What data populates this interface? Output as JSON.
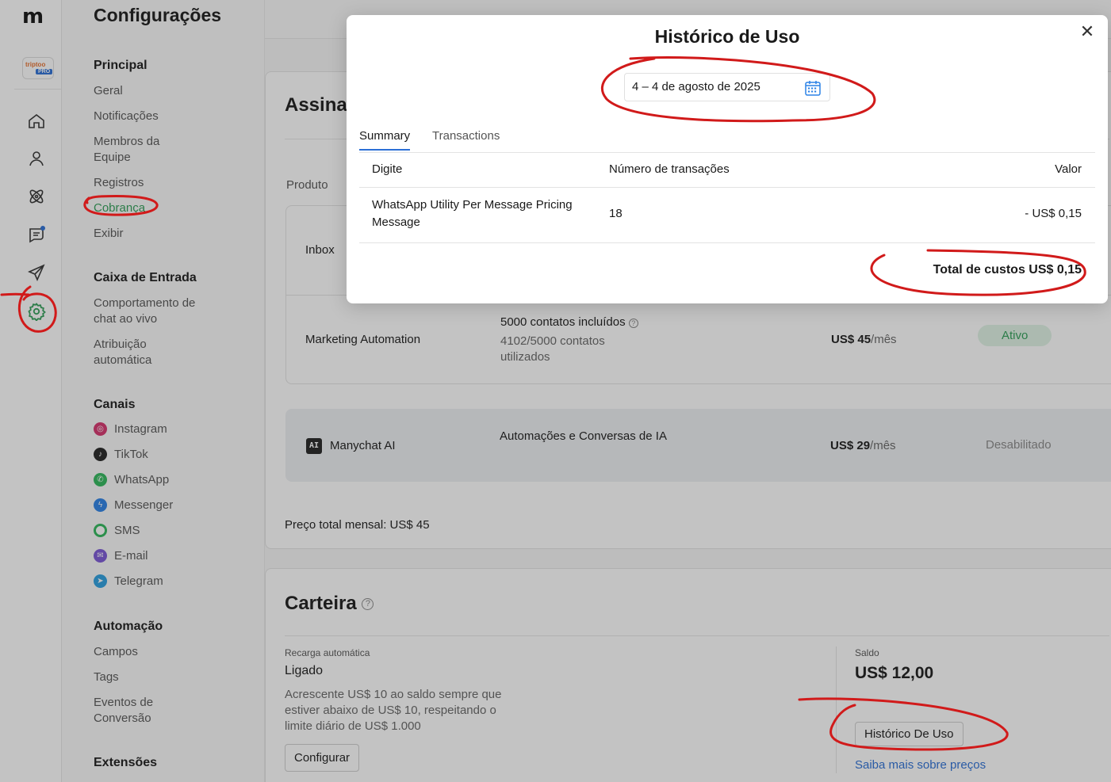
{
  "nav": {
    "page_title": "Configurações",
    "brand": {
      "name": "triptoo",
      "badge": "PRO"
    },
    "sections": {
      "principal": "Principal",
      "caixa": "Caixa de Entrada",
      "canais": "Canais",
      "automacao": "Automação",
      "extensoes": "Extensões"
    },
    "principal_items": [
      "Geral",
      "Notificações",
      "Membros da Equipe",
      "Registros",
      "Cobrança",
      "Exibir"
    ],
    "caixa_items": [
      "Comportamento de chat ao vivo",
      "Atribuição automática"
    ],
    "channels": [
      "Instagram",
      "TikTok",
      "WhatsApp",
      "Messenger",
      "SMS",
      "E-mail",
      "Telegram"
    ],
    "automacao_items": [
      "Campos",
      "Tags",
      "Eventos de Conversão"
    ]
  },
  "subscription": {
    "title": "Assinatura",
    "col_product": "Produto",
    "rows": [
      {
        "name": "Inbox"
      },
      {
        "name": "Marketing Automation",
        "detail": "5000 contatos incluídos",
        "usage": "4102/5000 contatos utilizados",
        "price": "US$ 45",
        "unit": "/mês",
        "status": "Ativo"
      },
      {
        "name": "Manychat AI",
        "badge": "AI",
        "detail": "Automações e Conversas de IA",
        "price": "US$ 29",
        "unit": "/mês",
        "status": "Desabilitado"
      }
    ],
    "total": "Preço total mensal: US$ 45"
  },
  "wallet": {
    "title": "Carteira",
    "recharge_label": "Recarga automática",
    "recharge_value": "Ligado",
    "recharge_desc": "Acrescente US$ 10 ao saldo sempre que estiver abaixo de US$ 10, respeitando o limite diário de US$ 1.000",
    "configure_button": "Configurar",
    "balance_label": "Saldo",
    "balance_value": "US$ 12,00",
    "history_button": "Histórico De Uso",
    "pricing_link": "Saiba mais sobre preços"
  },
  "modal": {
    "title": "Histórico de Uso",
    "date_range": "4 – 4 de agosto de 2025",
    "tabs": [
      "Summary",
      "Transactions"
    ],
    "columns": [
      "Digite",
      "Número de transações",
      "Valor"
    ],
    "rows": [
      {
        "type": "WhatsApp Utility Per Message Pricing Message",
        "count": "18",
        "value": "- US$ 0,15"
      }
    ],
    "total": "Total de custos US$ 0,15"
  },
  "colors": {
    "accent": "#2b6fd6",
    "active_green": "#2e9e57",
    "annotation_red": "#d11a1a"
  }
}
